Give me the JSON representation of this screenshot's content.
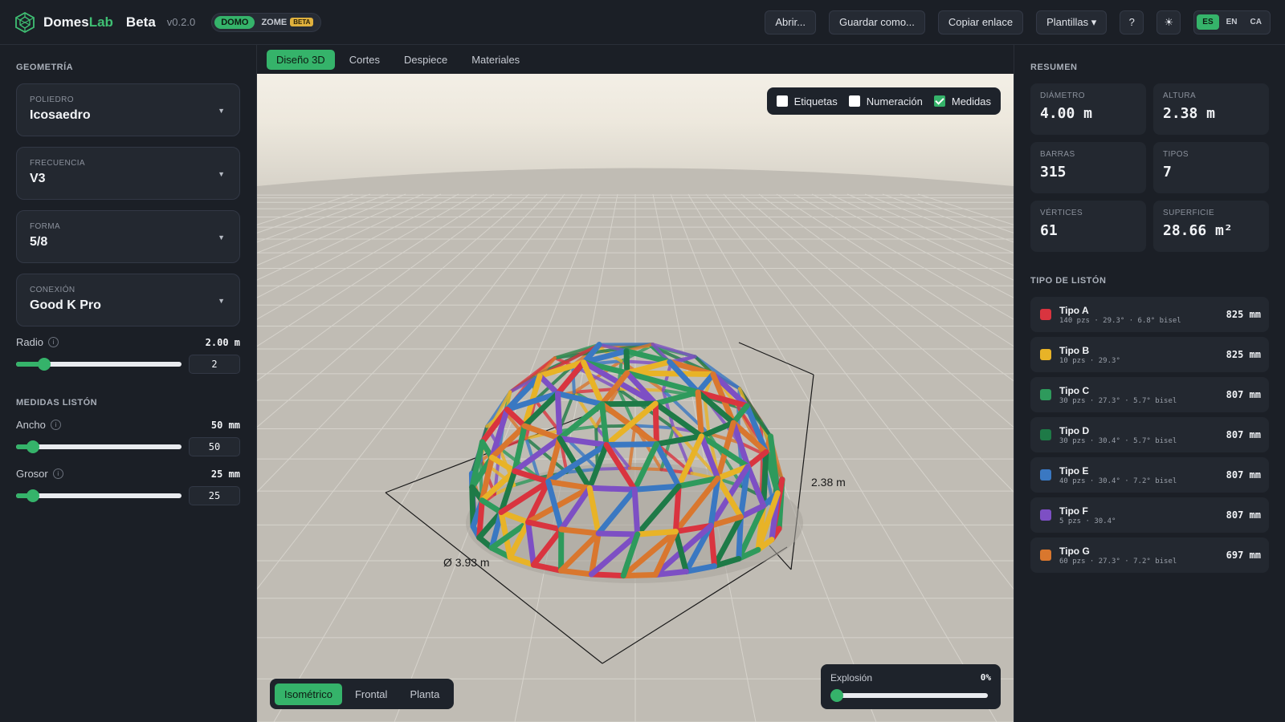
{
  "app": {
    "name_main": "Domes",
    "name_accent": "Lab",
    "beta_label": "Beta",
    "version": "v0.2.0",
    "mode_active": "DOMO",
    "mode_other": "ZOME",
    "mode_other_badge": "BETA"
  },
  "toolbar": {
    "open": "Abrir...",
    "save_as": "Guardar como...",
    "copy_link": "Copiar enlace",
    "templates": "Plantillas ▾",
    "help": "?",
    "theme": "☀",
    "languages": [
      "ES",
      "EN",
      "CA"
    ],
    "active_language": "ES"
  },
  "geometry": {
    "title": "GEOMETRÍA",
    "selects": [
      {
        "label": "POLIEDRO",
        "value": "Icosaedro"
      },
      {
        "label": "FRECUENCIA",
        "value": "V3"
      },
      {
        "label": "FORMA",
        "value": "5/8"
      },
      {
        "label": "CONEXIÓN",
        "value": "Good K Pro"
      }
    ],
    "radius": {
      "label": "Radio",
      "value_text": "2.00 m",
      "input": "2",
      "fraction": 0.17
    }
  },
  "strip": {
    "title": "MEDIDAS LISTÓN",
    "width": {
      "label": "Ancho",
      "value_text": "50 mm",
      "input": "50",
      "fraction": 0.1
    },
    "thickness": {
      "label": "Grosor",
      "value_text": "25 mm",
      "input": "25",
      "fraction": 0.1
    }
  },
  "tabs": [
    "Diseño 3D",
    "Cortes",
    "Despiece",
    "Materiales"
  ],
  "viewport": {
    "checks": [
      {
        "label": "Etiquetas",
        "checked": false
      },
      {
        "label": "Numeración",
        "checked": false
      },
      {
        "label": "Medidas",
        "checked": true
      }
    ],
    "height_dim": "2.38 m",
    "diameter_dim": "Ø 3.93 m",
    "views": [
      "Isométrico",
      "Frontal",
      "Planta"
    ],
    "active_view": "Isométrico",
    "explosion": {
      "label": "Explosión",
      "value_text": "0%",
      "fraction": 0
    }
  },
  "summary": {
    "title": "RESUMEN",
    "stats": [
      {
        "label": "DIÁMETRO",
        "value": "4.00 m"
      },
      {
        "label": "ALTURA",
        "value": "2.38 m"
      },
      {
        "label": "BARRAS",
        "value": "315"
      },
      {
        "label": "TIPOS",
        "value": "7"
      },
      {
        "label": "VÉRTICES",
        "value": "61"
      },
      {
        "label": "SUPERFICIE",
        "value": "28.66 m²"
      }
    ]
  },
  "strip_types": {
    "title": "TIPO DE LISTÓN",
    "items": [
      {
        "name": "Tipo A",
        "detail": "140 pzs · 29.3° · 6.8° bisel",
        "length": "825 mm",
        "color": "#d9343f"
      },
      {
        "name": "Tipo B",
        "detail": "10 pzs · 29.3°",
        "length": "825 mm",
        "color": "#e8b327"
      },
      {
        "name": "Tipo C",
        "detail": "30 pzs · 27.3° · 5.7° bisel",
        "length": "807 mm",
        "color": "#2e9a5c"
      },
      {
        "name": "Tipo D",
        "detail": "30 pzs · 30.4° · 5.7° bisel",
        "length": "807 mm",
        "color": "#1e7a47"
      },
      {
        "name": "Tipo E",
        "detail": "40 pzs · 30.4° · 7.2° bisel",
        "length": "807 mm",
        "color": "#3a78c2"
      },
      {
        "name": "Tipo F",
        "detail": "5 pzs · 30.4°",
        "length": "807 mm",
        "color": "#7d4fc4"
      },
      {
        "name": "Tipo G",
        "detail": "60 pzs · 27.3° · 7.2° bisel",
        "length": "697 mm",
        "color": "#d9772e"
      }
    ]
  }
}
